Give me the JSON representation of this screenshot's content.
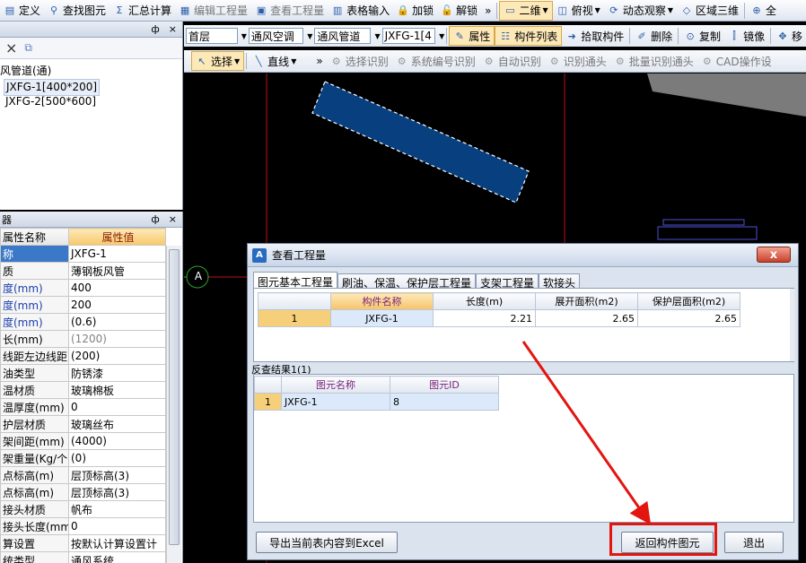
{
  "toolbar1": {
    "items": [
      "定义",
      "查找图元",
      "汇总计算",
      "编辑工程量",
      "查看工程量",
      "表格输入",
      "加锁",
      "解锁"
    ],
    "overflow": "»",
    "view_mode": "二维",
    "view_dir": "俯视",
    "dynamic": "动态观察",
    "region3d": "区域三维",
    "last": "全"
  },
  "left_top": {
    "pin": "ф",
    "close": "×",
    "tree_root": "风管道(通)",
    "tree_items": [
      "JXFG-1[400*200]",
      "JXFG-2[500*600]"
    ]
  },
  "left_bottom": {
    "title_suffix": "器",
    "pin": "ф",
    "close": "×",
    "headers": [
      "属性名称",
      "属性值"
    ],
    "rows": [
      {
        "name": "称",
        "value": "JXFG-1"
      },
      {
        "name": "质",
        "value": "薄钢板风管"
      },
      {
        "name": "度(mm)",
        "value": "400"
      },
      {
        "name": "度(mm)",
        "value": "200"
      },
      {
        "name": "度(mm)",
        "value": "(0.6)"
      },
      {
        "name": "长(mm)",
        "value": "(1200)"
      },
      {
        "name": "线距左边线距",
        "value": "(200)"
      },
      {
        "name": "油类型",
        "value": "防锈漆"
      },
      {
        "name": "温材质",
        "value": "玻璃棉板"
      },
      {
        "name": "温厚度(mm)",
        "value": "0"
      },
      {
        "name": "护层材质",
        "value": "玻璃丝布"
      },
      {
        "name": "架间距(mm)",
        "value": "(4000)"
      },
      {
        "name": "架重量(Kg/个",
        "value": "(0)"
      },
      {
        "name": "点标高(m)",
        "value": "层顶标高(3)"
      },
      {
        "name": "点标高(m)",
        "value": "层顶标高(3)"
      },
      {
        "name": "接头材质",
        "value": "帆布"
      },
      {
        "name": "接头长度(mm)",
        "value": "0"
      },
      {
        "name": "算设置",
        "value": "按默认计算设置计"
      },
      {
        "name": "统类型",
        "value": "通风系统"
      }
    ]
  },
  "toolbar2": {
    "floor": "首层",
    "major": "通风空调",
    "type": "通风管道",
    "comp": "JXFG-1[4",
    "attr": "属性",
    "comp_list": "构件列表",
    "pick": "拾取构件",
    "delete": "删除",
    "copy": "复制",
    "mirror": "镜像",
    "move": "移"
  },
  "toolbar3": {
    "select": "选择",
    "line": "直线",
    "overflow": "»",
    "items": [
      "选择识别",
      "系统编号识别",
      "自动识别",
      "识别通头",
      "批量识别通头",
      "CAD操作设"
    ]
  },
  "canvas": {
    "axis_label": "A"
  },
  "dialog": {
    "title": "查看工程量",
    "close": "x",
    "tabs": [
      "图元基本工程量",
      "刷油、保温、保护层工程量",
      "支架工程量",
      "软接头"
    ],
    "qty_headers": [
      "构件名称",
      "长度(m)",
      "展开面积(m2)",
      "保护层面积(m2)"
    ],
    "qty_rows": [
      {
        "idx": "1",
        "name": "JXFG-1",
        "length": "2.21",
        "area": "2.65",
        "cover": "2.65"
      }
    ],
    "reverse_title": "反查结果1(1)",
    "rev_headers": [
      "图元名称",
      "图元ID"
    ],
    "rev_rows": [
      {
        "idx": "1",
        "name": "JXFG-1",
        "id": "8"
      }
    ],
    "export_btn": "导出当前表内容到Excel",
    "return_btn": "返回构件图元",
    "exit_btn": "退出"
  }
}
